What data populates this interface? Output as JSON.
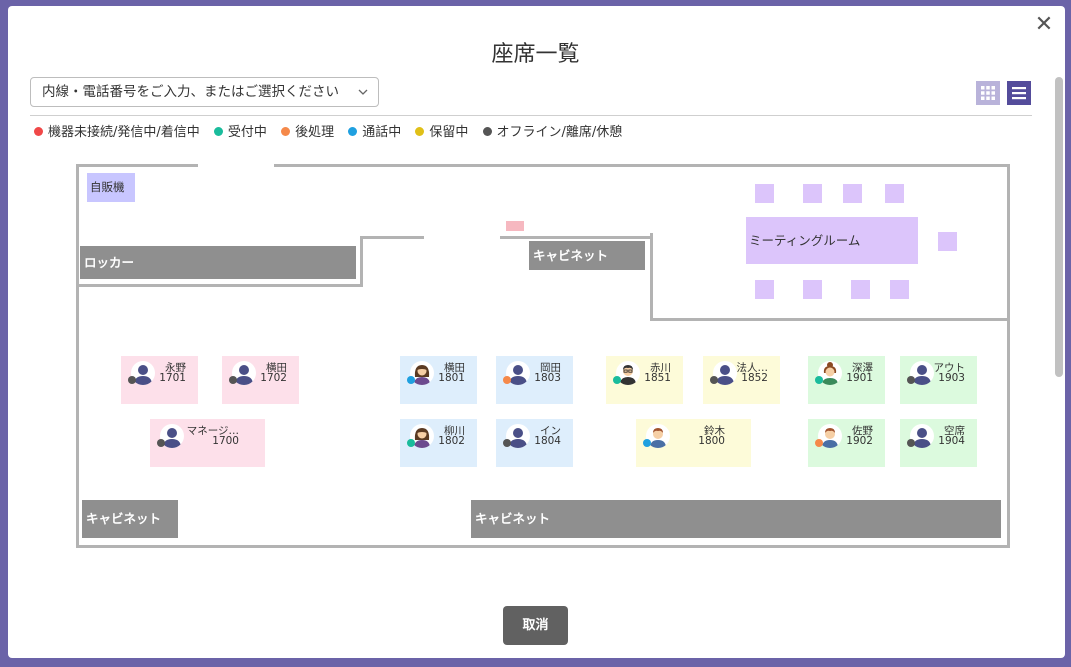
{
  "dialog": {
    "title": "座席一覧",
    "close_icon": "close-icon",
    "cancel_label": "取消"
  },
  "search": {
    "placeholder": "内線・電話番号をご入力、またはご選択ください"
  },
  "view_toggle": {
    "grid_icon": "grid-view-icon",
    "list_icon": "list-view-icon",
    "active": "list"
  },
  "legend": [
    {
      "label": "機器未接続/発信中/着信中",
      "color": "#f04848"
    },
    {
      "label": "受付中",
      "color": "#1abc9c"
    },
    {
      "label": "後処理",
      "color": "#f5894a"
    },
    {
      "label": "通話中",
      "color": "#1fa0e0"
    },
    {
      "label": "保留中",
      "color": "#e0c018"
    },
    {
      "label": "オフライン/離席/休憩",
      "color": "#555555"
    }
  ],
  "floor": {
    "vending_machine": "自販機",
    "locker": "ロッカー",
    "cabinet_top": "キャビネット",
    "meeting_room": "ミーティングルーム",
    "cabinet_bottom_left": "キャビネット",
    "cabinet_bottom_right": "キャビネット"
  },
  "seats": [
    {
      "name": "永野",
      "ext": "1701",
      "zone": "pink",
      "status_color": "#555555",
      "avatar": "default"
    },
    {
      "name": "横田",
      "ext": "1702",
      "zone": "pink",
      "status_color": "#555555",
      "avatar": "default"
    },
    {
      "name": "マネージ…",
      "ext": "1700",
      "zone": "pink",
      "status_color": "#555555",
      "avatar": "default"
    },
    {
      "name": "横田",
      "ext": "1801",
      "zone": "blue",
      "status_color": "#1fa0e0",
      "avatar": "woman"
    },
    {
      "name": "岡田",
      "ext": "1803",
      "zone": "blue",
      "status_color": "#f5894a",
      "avatar": "default"
    },
    {
      "name": "柳川",
      "ext": "1802",
      "zone": "blue",
      "status_color": "#1abc9c",
      "avatar": "woman"
    },
    {
      "name": "イン",
      "ext": "1804",
      "zone": "blue",
      "status_color": "#555555",
      "avatar": "default"
    },
    {
      "name": "赤川",
      "ext": "1851",
      "zone": "yellow",
      "status_color": "#1abc9c",
      "avatar": "man-glasses"
    },
    {
      "name": "法人…",
      "ext": "1852",
      "zone": "yellow",
      "status_color": "#555555",
      "avatar": "default"
    },
    {
      "name": "鈴木",
      "ext": "1800",
      "zone": "yellow",
      "status_color": "#1fa0e0",
      "avatar": "man"
    },
    {
      "name": "深澤",
      "ext": "1901",
      "zone": "green",
      "status_color": "#1abc9c",
      "avatar": "woman-bun"
    },
    {
      "name": "アウト",
      "ext": "1903",
      "zone": "green",
      "status_color": "#555555",
      "avatar": "default"
    },
    {
      "name": "佐野",
      "ext": "1902",
      "zone": "green",
      "status_color": "#f5894a",
      "avatar": "man"
    },
    {
      "name": "空席",
      "ext": "1904",
      "zone": "green",
      "status_color": "#555555",
      "avatar": "default"
    }
  ]
}
